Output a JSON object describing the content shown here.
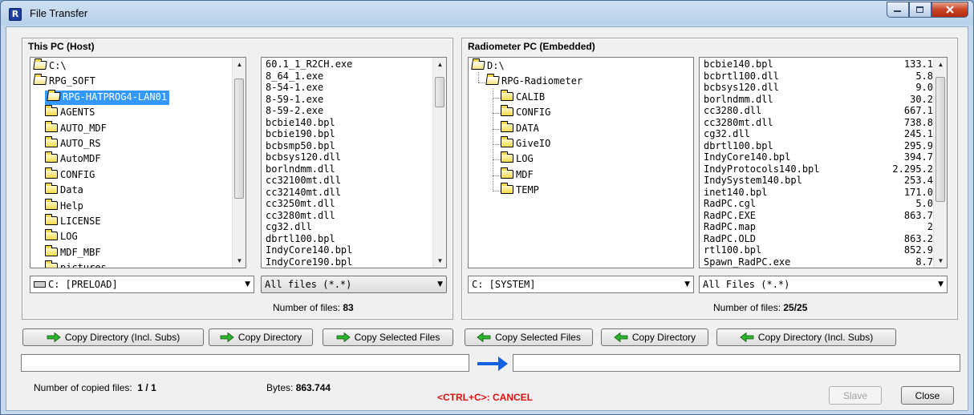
{
  "window": {
    "title": "File Transfer",
    "app_icon_glyph": "R"
  },
  "host": {
    "title": "This PC (Host)",
    "tree": [
      {
        "label": "C:\\",
        "level": 0,
        "open": true
      },
      {
        "label": "RPG_SOFT",
        "level": 0,
        "open": true
      },
      {
        "label": "RPG-HATPROG4-LAN01",
        "level": 1,
        "open": true,
        "selected": true
      },
      {
        "label": "AGENTS",
        "level": 1
      },
      {
        "label": "AUTO_MDF",
        "level": 1
      },
      {
        "label": "AUTO_RS",
        "level": 1
      },
      {
        "label": "AutoMDF",
        "level": 1
      },
      {
        "label": "CONFIG",
        "level": 1
      },
      {
        "label": "Data",
        "level": 1
      },
      {
        "label": "Help",
        "level": 1
      },
      {
        "label": "LICENSE",
        "level": 1
      },
      {
        "label": "LOG",
        "level": 1
      },
      {
        "label": "MDF_MBF",
        "level": 1
      },
      {
        "label": "pictures",
        "level": 1
      }
    ],
    "files": [
      "60.1_1_R2CH.exe",
      "8_64_1.exe",
      "8-54-1.exe",
      "8-59-1.exe",
      "8-59-2.exe",
      "bcbie140.bpl",
      "bcbie190.bpl",
      "bcbsmp50.bpl",
      "bcbsys120.dll",
      "borlndmm.dll",
      "cc32100mt.dll",
      "cc32140mt.dll",
      "cc3250mt.dll",
      "cc3280mt.dll",
      "cg32.dll",
      "dbrtl100.bpl",
      "IndyCore140.bpl",
      "IndyCore190.bpl"
    ],
    "drive": "C: [PRELOAD]",
    "filter": "All files (*.*)",
    "count_label": "Number of files:",
    "count_value": "83"
  },
  "radiometer": {
    "title": "Radiometer PC (Embedded)",
    "tree": [
      {
        "label": "D:\\",
        "level": 0,
        "open": true
      },
      {
        "label": "RPG-Radiometer",
        "level": 1,
        "open": true
      },
      {
        "label": "CALIB",
        "level": 2
      },
      {
        "label": "CONFIG",
        "level": 2
      },
      {
        "label": "DATA",
        "level": 2
      },
      {
        "label": "GiveIO",
        "level": 2
      },
      {
        "label": "LOG",
        "level": 2
      },
      {
        "label": "MDF",
        "level": 2
      },
      {
        "label": "TEMP",
        "level": 2
      }
    ],
    "files": [
      {
        "name": "bcbie140.bpl",
        "size": "133.1"
      },
      {
        "name": "bcbrtl100.dll",
        "size": "5.8"
      },
      {
        "name": "bcbsys120.dll",
        "size": "9.0"
      },
      {
        "name": "borlndmm.dll",
        "size": "30.2"
      },
      {
        "name": "cc3280.dll",
        "size": "667.1"
      },
      {
        "name": "cc3280mt.dll",
        "size": "738.8"
      },
      {
        "name": "cg32.dll",
        "size": "245.1"
      },
      {
        "name": "dbrtl100.bpl",
        "size": "295.9"
      },
      {
        "name": "IndyCore140.bpl",
        "size": "394.7"
      },
      {
        "name": "IndyProtocols140.bpl",
        "size": "2.295.2"
      },
      {
        "name": "IndySystem140.bpl",
        "size": "253.4"
      },
      {
        "name": "inet140.bpl",
        "size": "171.0"
      },
      {
        "name": "RadPC.cgl",
        "size": "5.0"
      },
      {
        "name": "RadPC.EXE",
        "size": "863.7"
      },
      {
        "name": "RadPC.map",
        "size": "2"
      },
      {
        "name": "RadPC.OLD",
        "size": "863.2"
      },
      {
        "name": "rtl100.bpl",
        "size": "852.9"
      },
      {
        "name": "Spawn_RadPC.exe",
        "size": "8.7"
      }
    ],
    "drive": "C: [SYSTEM]",
    "filter": "All Files (*.*)",
    "count_label": "Number of files:",
    "count_value": "25/25"
  },
  "buttons": {
    "copy_dir_subs_right": "Copy Directory (Incl. Subs)",
    "copy_dir_right": "Copy Directory",
    "copy_selected_right": "Copy Selected Files",
    "copy_selected_left": "Copy Selected Files",
    "copy_dir_left": "Copy Directory",
    "copy_dir_subs_left": "Copy Directory (Incl. Subs)"
  },
  "transfer": {
    "source_path": "",
    "dest_path": ""
  },
  "status": {
    "copied_label": "Number of copied files:",
    "copied_value": "1 / 1",
    "bytes_label": "Bytes:",
    "bytes_value": "863.744",
    "cancel_hint": "<CTRL+C>: CANCEL"
  },
  "dialog": {
    "slave": "Slave",
    "close": "Close"
  },
  "colors": {
    "green_arrow": "#2db52d",
    "transfer_arrow": "#1060e0",
    "cancel": "#e01010",
    "selection": "#3399ff"
  }
}
